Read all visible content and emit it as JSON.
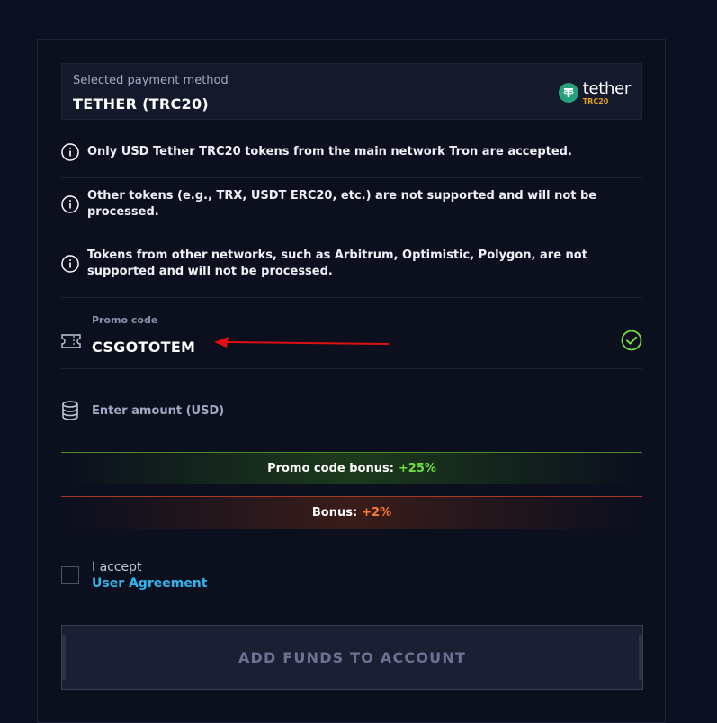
{
  "payment_method": {
    "label": "Selected payment method",
    "value": "TETHER (TRC20)",
    "logo": {
      "name": "tether",
      "network": "TRC20",
      "brand_color": "#26a17b",
      "network_color": "#e2a11b"
    }
  },
  "notices": [
    {
      "icon": "info-icon",
      "text": "Only USD Tether TRC20 tokens from the main network Tron are accepted."
    },
    {
      "icon": "info-icon",
      "text": "Other tokens (e.g., TRX, USDT ERC20, etc.) are not supported and will not be processed."
    },
    {
      "icon": "info-icon",
      "text": "Tokens from other networks, such as Arbitrum, Optimistic, Polygon, are not supported and will not be processed."
    }
  ],
  "promo": {
    "label": "Promo code",
    "value": "CSGOTOTEM",
    "icon": "ticket-icon",
    "status_icon": "check-circle-icon",
    "status_color": "#73e03a"
  },
  "amount": {
    "placeholder": "Enter amount (USD)",
    "icon": "coins-icon"
  },
  "bonuses": {
    "promo": {
      "label": "Promo code bonus:",
      "value": "+25%",
      "color": "#73e03a"
    },
    "deposit": {
      "label": "Bonus:",
      "value": "+2%",
      "color": "#ff7a2a"
    }
  },
  "agreement": {
    "text": "I accept",
    "link": "User Agreement",
    "link_color": "#2fb6f0"
  },
  "submit": {
    "label": "ADD FUNDS TO ACCOUNT"
  },
  "annotation": {
    "arrow_color": "#e01010"
  }
}
